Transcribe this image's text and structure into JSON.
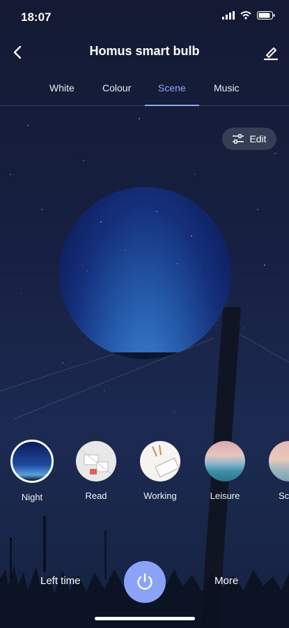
{
  "status_bar": {
    "time": "18:07"
  },
  "nav": {
    "title": "Homus smart bulb"
  },
  "tabs": [
    {
      "label": "White",
      "active": false
    },
    {
      "label": "Colour",
      "active": false
    },
    {
      "label": "Scene",
      "active": true
    },
    {
      "label": "Music",
      "active": false
    }
  ],
  "edit_button": {
    "label": "Edit"
  },
  "scenes": [
    {
      "label": "Night",
      "selected": true
    },
    {
      "label": "Read",
      "selected": false
    },
    {
      "label": "Working",
      "selected": false
    },
    {
      "label": "Leisure",
      "selected": false
    },
    {
      "label": "Sc",
      "selected": false
    }
  ],
  "bottom": {
    "left_time": "Left time",
    "more": "More"
  },
  "colors": {
    "accent": "#8fa5ff",
    "power": "#8aa3f8",
    "background": "#172042"
  }
}
